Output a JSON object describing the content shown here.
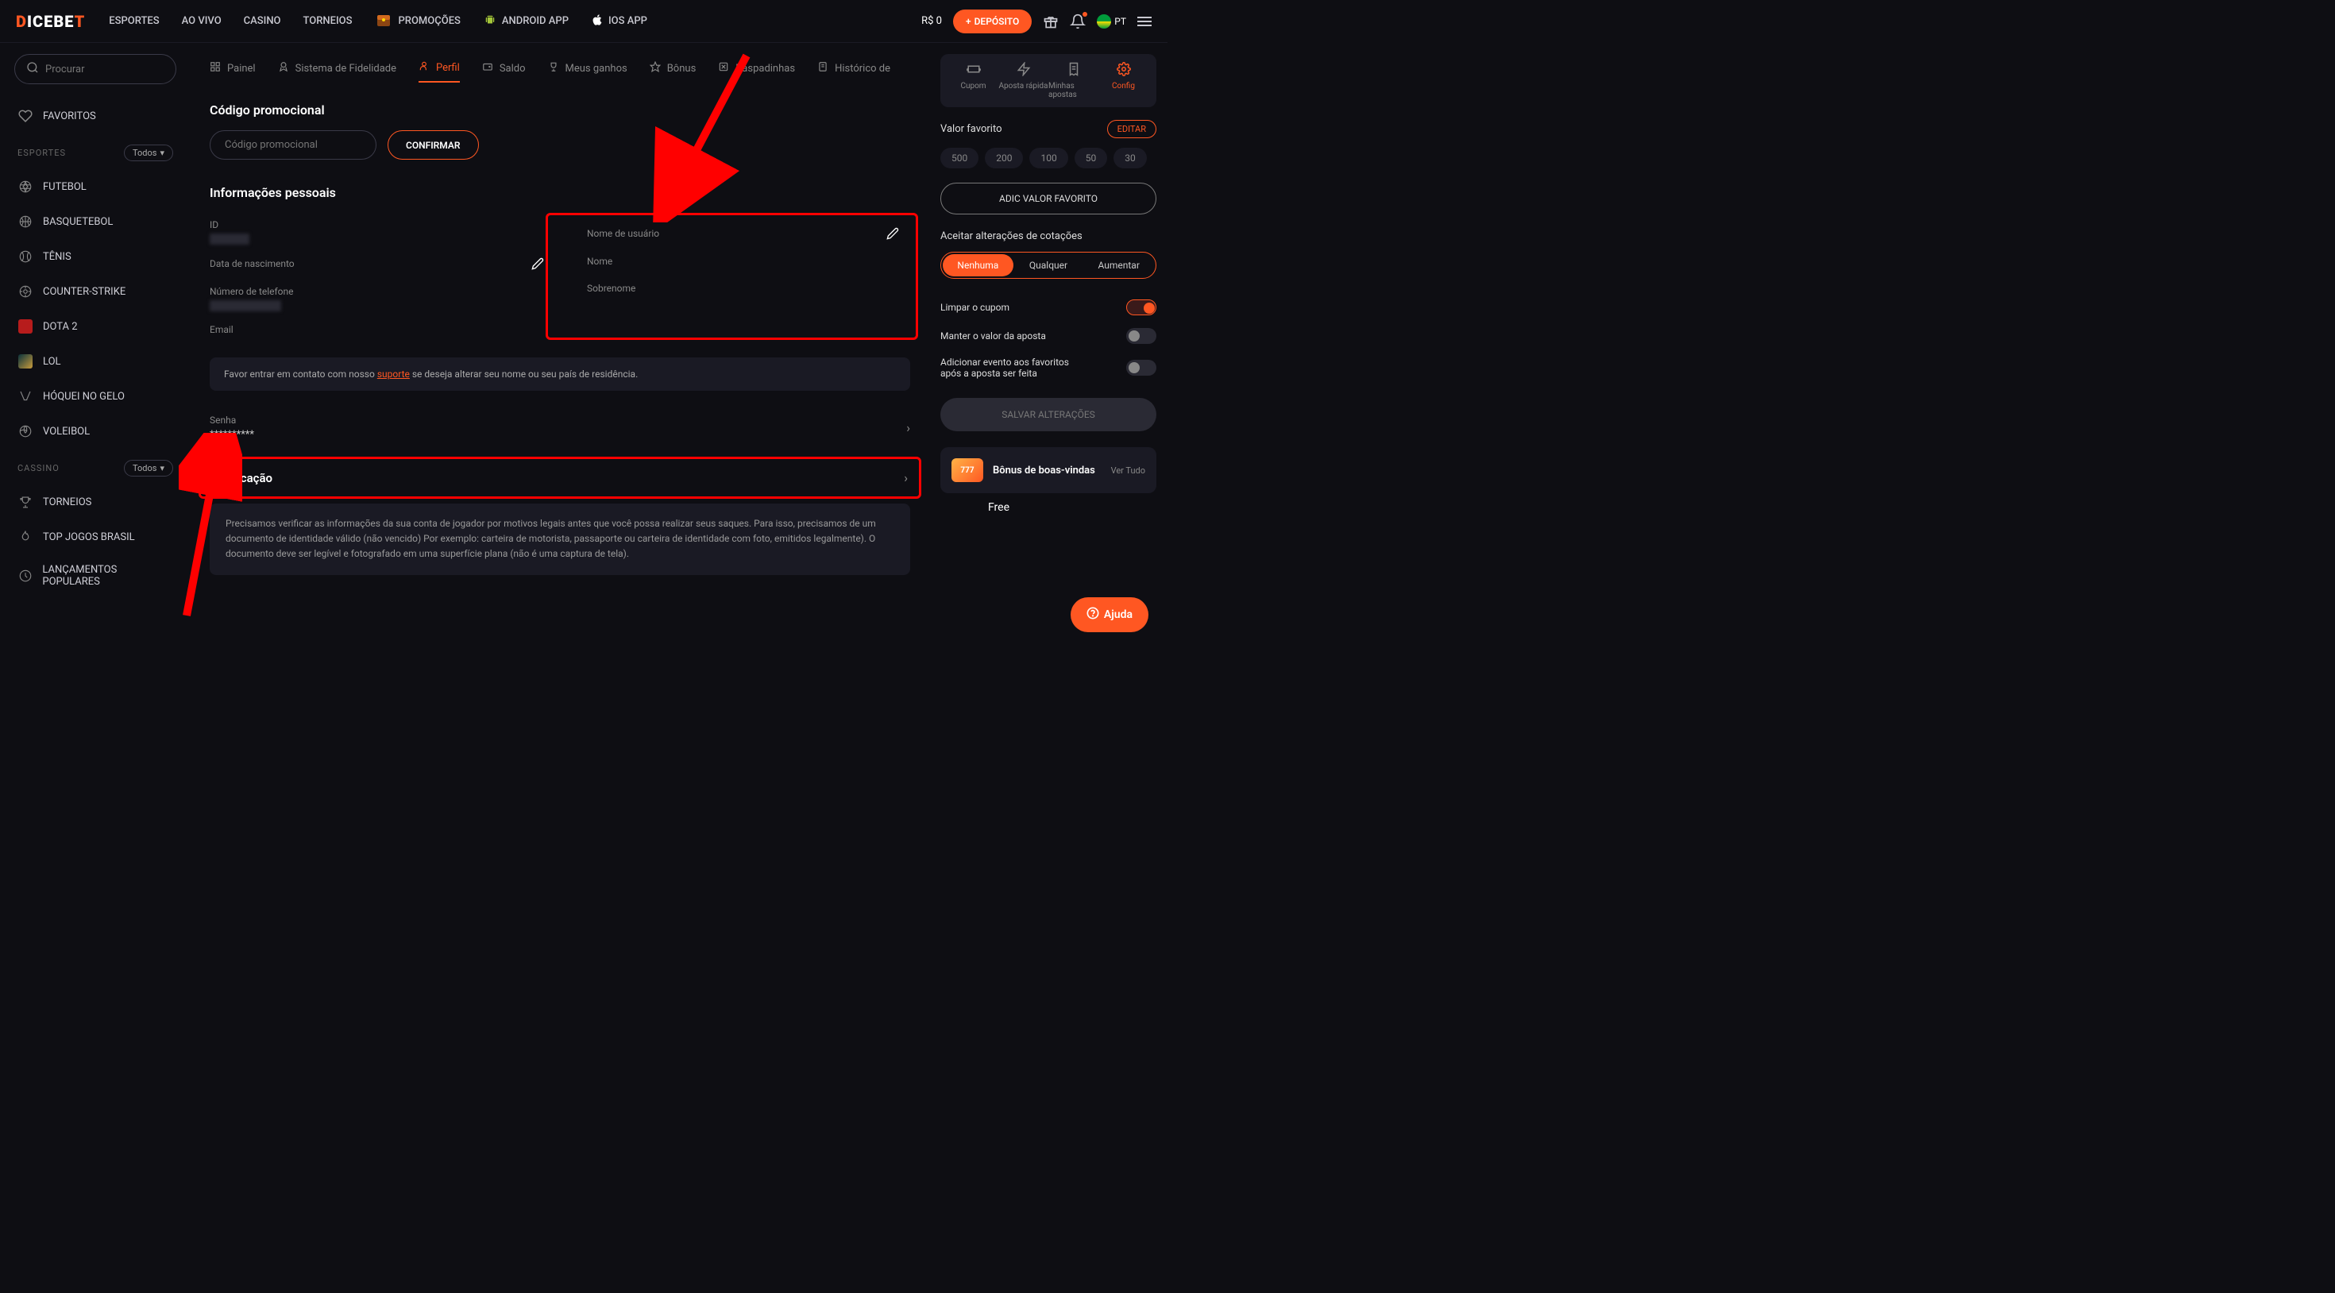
{
  "header": {
    "logo": "DICEBET",
    "nav": [
      "ESPORTES",
      "AO VIVO",
      "CASINO",
      "TORNEIOS",
      "PROMOÇÕES",
      "ANDROID APP",
      "IOS APP"
    ],
    "balance": "R$ 0",
    "deposit": "DEPÓSITO",
    "lang": "PT"
  },
  "sidebar": {
    "search_placeholder": "Procurar",
    "favorites": "FAVORITOS",
    "sections": {
      "esportes": {
        "label": "ESPORTES",
        "filter": "Todos"
      },
      "cassino": {
        "label": "CASSINO",
        "filter": "Todos"
      }
    },
    "sports": [
      "FUTEBOL",
      "BASQUETEBOL",
      "TÊNIS",
      "COUNTER-STRIKE",
      "DOTA 2",
      "LOL",
      "HÓQUEI NO GELO",
      "VOLEIBOL"
    ],
    "cassino_items": [
      "TORNEIOS",
      "TOP JOGOS BRASIL",
      "LANÇAMENTOS POPULARES"
    ]
  },
  "tabs": [
    "Painel",
    "Sistema de Fidelidade",
    "Perfil",
    "Saldo",
    "Meus ganhos",
    "Bônus",
    "Raspadinhas",
    "Histórico de"
  ],
  "profile": {
    "promo_title": "Código promocional",
    "promo_placeholder": "Código promocional",
    "confirm": "CONFIRMAR",
    "info_title": "Informações pessoais",
    "fields": {
      "id": "ID",
      "dob": "Data de nascimento",
      "phone": "Número de telefone",
      "email": "Email",
      "username": "Nome de usuário",
      "name": "Nome",
      "surname": "Sobrenome",
      "password": "Senha",
      "password_val": "**********"
    },
    "notice_pre": "Favor entrar em contato com nosso ",
    "notice_link": "suporte",
    "notice_post": " se deseja alterar seu nome ou seu país de residência.",
    "verification": "Verificação",
    "verify_desc": "Precisamos verificar as informações da sua conta de jogador por motivos legais antes que você possa realizar seus saques. Para isso, precisamos de um documento de identidade válido (não vencido) Por exemplo: carteira de motorista, passaporte ou carteira de identidade com foto, emitidos legalmente). O documento deve ser legível e fotografado em uma superfície plana (não é uma captura de tela)."
  },
  "rightbar": {
    "tabs": [
      "Cupom",
      "Aposta rápida",
      "Minhas apostas",
      "Config"
    ],
    "fav_value": "Valor favorito",
    "edit": "EDITAR",
    "chips": [
      "500",
      "200",
      "100",
      "50",
      "30"
    ],
    "add_fav": "ADIC VALOR FAVORITO",
    "odds_title": "Aceitar alterações de cotações",
    "odds_opts": [
      "Nenhuma",
      "Qualquer",
      "Aumentar"
    ],
    "toggles": {
      "clear": "Limpar o cupom",
      "keep": "Manter o valor da aposta",
      "addfav": "Adicionar evento aos favoritos após a aposta ser feita"
    },
    "save": "SALVAR ALTERAÇÕES",
    "bonus_title": "Bônus de boas-vindas",
    "bonus_link": "Ver Tudo",
    "free": "Free"
  },
  "help": "Ajuda"
}
